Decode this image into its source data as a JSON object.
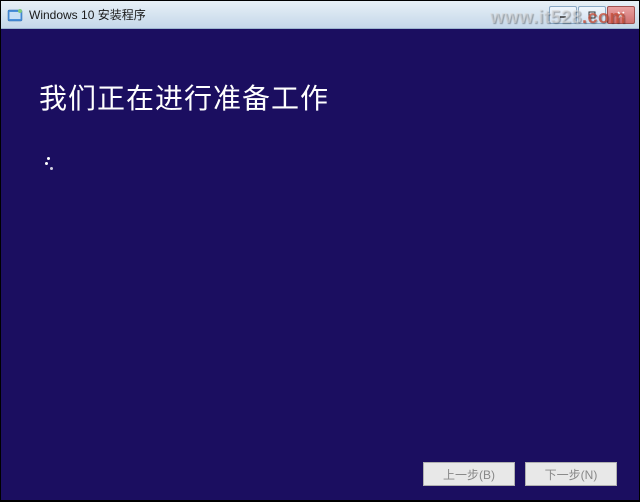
{
  "window": {
    "title": "Windows 10 安装程序"
  },
  "content": {
    "heading": "我们正在进行准备工作"
  },
  "buttons": {
    "back": "上一步(B)",
    "next": "下一步(N)"
  },
  "watermark": {
    "text_a": "www.it528",
    "text_b": ".com"
  }
}
